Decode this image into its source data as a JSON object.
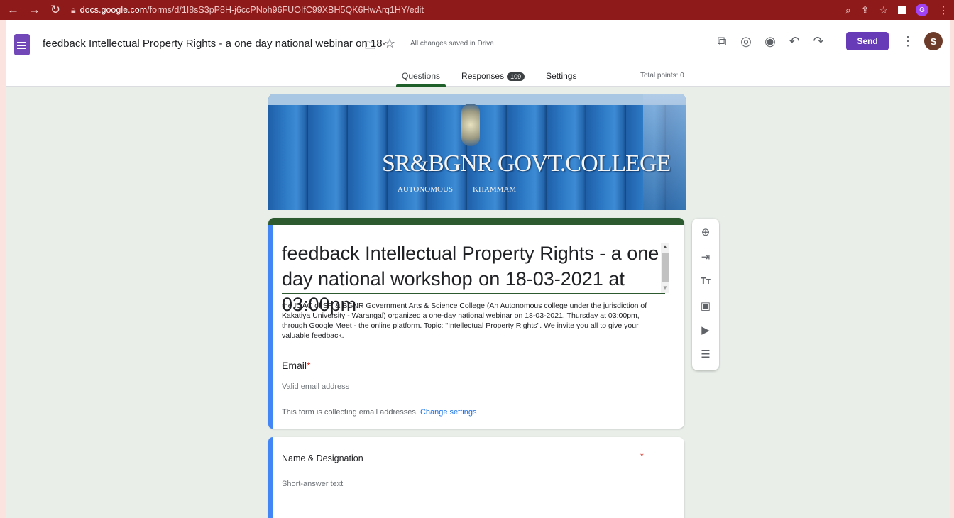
{
  "browser": {
    "url_host": "docs.google.com",
    "url_path": "/forms/d/1I8sS3pP8H-j6ccPNoh96FUOIfC99XBH5QK6HwArq1HY/edit",
    "profile_initial": "G"
  },
  "header": {
    "doc_title": "feedback Intellectual Property Rights - a one day national webinar on 18-",
    "save_status": "All changes saved in Drive",
    "send_label": "Send",
    "avatar_initial": "S",
    "icons": [
      "addon-icon",
      "palette-icon",
      "preview-eye-icon",
      "undo-icon",
      "redo-icon",
      "more-vert-icon"
    ]
  },
  "tabs": [
    {
      "label": "Questions",
      "active": true
    },
    {
      "label": "Responses",
      "badge": "109",
      "active": false
    },
    {
      "label": "Settings",
      "active": false
    }
  ],
  "total_points": "Total points: 0",
  "banner": {
    "college": "SR&BGNR GOVT.COLLEGE",
    "line1": "AUTONOMOUS",
    "line2": "KHAMMAM"
  },
  "form": {
    "title_part1": "feedback Intellectual Property Rights - a one day national workshop",
    "title_part2": " on 18-03-2021 at 03:00pm",
    "description": "the IQAC of SR & BGNR Government Arts & Science College (An Autonomous college under the jurisdiction of Kakatiya University - Warangal) organized a one-day national webinar on 18-03-2021, Thursday at 03:00pm, through Google Meet - the online platform. Topic: \"Intellectual Property Rights\". We invite you all to give your valuable feedback.",
    "email_label": "Email",
    "required_mark": "*",
    "email_placeholder": "Valid email address",
    "collecting_text": "This form is collecting email addresses.",
    "change_settings": "Change settings"
  },
  "question": {
    "title": "Name & Designation",
    "required_mark": "*",
    "placeholder": "Short-answer text"
  },
  "toolbar": [
    "add-question-icon",
    "import-questions-icon",
    "add-title-icon",
    "add-image-icon",
    "add-video-icon",
    "add-section-icon"
  ],
  "colors": {
    "chrome": "#8e1a1a",
    "accent": "#673ab7",
    "theme": "#2d5a2f",
    "active_bar": "#4285f4"
  }
}
